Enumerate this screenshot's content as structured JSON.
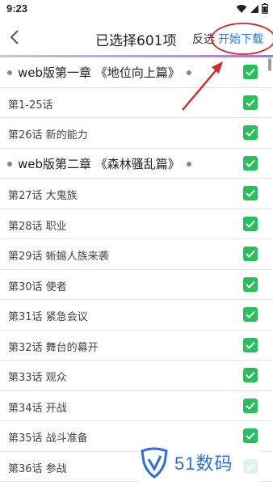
{
  "status_bar": {
    "time": "9:23"
  },
  "header": {
    "title": "已选择601项",
    "invert_label": "反选",
    "download_label": "开始下载"
  },
  "items": [
    {
      "type": "chapter",
      "label": "web版第一章 《地位向上篇》"
    },
    {
      "type": "episode",
      "label": "第1-25话"
    },
    {
      "type": "episode",
      "label": "第26话 新的能力"
    },
    {
      "type": "chapter",
      "label": "web版第二章 《森林骚乱篇》"
    },
    {
      "type": "episode",
      "label": "第27话 大鬼族"
    },
    {
      "type": "episode",
      "label": "第28话 职业"
    },
    {
      "type": "episode",
      "label": "第29话 蜥蜴人族来袭"
    },
    {
      "type": "episode",
      "label": "第30话 使者"
    },
    {
      "type": "episode",
      "label": "第31话 紧急会议"
    },
    {
      "type": "episode",
      "label": "第32话 舞台的幕开"
    },
    {
      "type": "episode",
      "label": "第33话 观众"
    },
    {
      "type": "episode",
      "label": "第34话 开战"
    },
    {
      "type": "episode",
      "label": "第35话 战斗准备"
    },
    {
      "type": "episode",
      "label": "第36话 参战"
    }
  ],
  "watermark": {
    "text": "51数码"
  },
  "colors": {
    "check": "#27c05a",
    "accent": "#2b7be4",
    "annotation": "#d42a2a"
  }
}
